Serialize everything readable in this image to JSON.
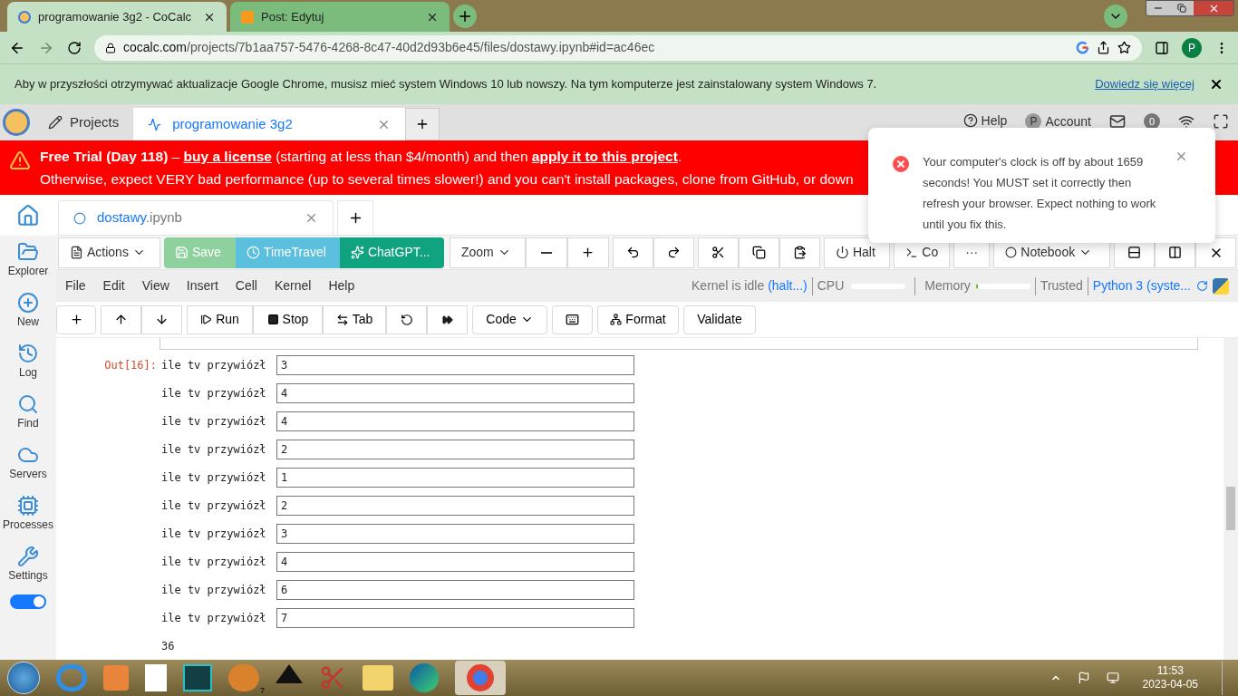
{
  "browser": {
    "tabs": [
      {
        "title": "programowanie 3g2 - CoCalc",
        "selected": true
      },
      {
        "title": "Post: Edytuj",
        "selected": false
      }
    ],
    "url": {
      "host": "cocalc.com",
      "path": "/projects/7b1aa757-5476-4268-8c47-40d2d93b6e45/files/dostawy.ipynb#id=ac46ec"
    },
    "profile": "P"
  },
  "update_bar": {
    "message": "Aby w przyszłości otrzymywać aktualizacje Google Chrome, musisz mieć system Windows 10 lub nowszy. Na tym komputerze jest zainstalowany system Windows 7.",
    "link": "Dowiedz się więcej"
  },
  "top_bar": {
    "projects": "Projects",
    "project_tab": {
      "title": "programowanie 3g2",
      "selected": true
    },
    "help": "Help",
    "account": "Account",
    "account_initial": "P",
    "notifications": "0"
  },
  "banner": {
    "line1": [
      {
        "kind": "bold",
        "text": "Free Trial (Day 118)"
      },
      {
        "kind": "plain",
        "text": " – "
      },
      {
        "kind": "link",
        "text": "buy a license"
      },
      {
        "kind": "plain",
        "text": " (starting at less than $4/month) and then "
      },
      {
        "kind": "link",
        "text": "apply it to this project"
      },
      {
        "kind": "plain",
        "text": "."
      }
    ],
    "line2": "Otherwise, expect VERY bad performance (up to several times slower!) and you can't install packages, clone from GitHub, or down"
  },
  "sidebar": {
    "items": [
      {
        "label": "Explorer"
      },
      {
        "label": "New"
      },
      {
        "label": "Log"
      },
      {
        "label": "Find"
      },
      {
        "label": "Servers"
      },
      {
        "label": "Processes"
      },
      {
        "label": "Settings"
      }
    ],
    "toggle_on": true
  },
  "file_tab": {
    "name": "dostawy",
    "ext": ".ipynb",
    "selected": true
  },
  "toolbar": {
    "actions": "Actions",
    "save": "Save",
    "timetravel": "TimeTravel",
    "chatgpt": "ChatGPT...",
    "zoom": "Zoom",
    "halt": "Halt",
    "terminal": "Co",
    "more": "···",
    "view": "Notebook"
  },
  "menu": [
    "File",
    "Edit",
    "View",
    "Insert",
    "Cell",
    "Kernel",
    "Help"
  ],
  "status": {
    "kernel": "Kernel is idle",
    "halt": "(halt...)",
    "cpu": "CPU",
    "cpu_meter": {
      "level": 0
    },
    "memory": "Memory",
    "memory_meter": {
      "level": 0.03
    },
    "trusted": "Trusted",
    "kernel_name": "Python 3 (syste..."
  },
  "cell_toolbar": {
    "run": "Run",
    "stop": "Stop",
    "tab": "Tab",
    "cell_type": "Code",
    "format": "Format",
    "validate": "Validate"
  },
  "output": {
    "prompt": "Out[16]:",
    "rows": [
      {
        "label": "ile tv przywiózł",
        "value": "3"
      },
      {
        "label": "ile tv przywiózł",
        "value": "4"
      },
      {
        "label": "ile tv przywiózł",
        "value": "4"
      },
      {
        "label": "ile tv przywiózł",
        "value": "2"
      },
      {
        "label": "ile tv przywiózł",
        "value": "1"
      },
      {
        "label": "ile tv przywiózł",
        "value": "2"
      },
      {
        "label": "ile tv przywiózł",
        "value": "3"
      },
      {
        "label": "ile tv przywiózł",
        "value": "4"
      },
      {
        "label": "ile tv przywiózł",
        "value": "6"
      },
      {
        "label": "ile tv przywiózł",
        "value": "7"
      }
    ],
    "result": "36"
  },
  "notification": {
    "message": "Your computer's clock is off by about 1659 seconds! You MUST set it correctly then refresh your browser. Expect nothing to work until you fix this."
  },
  "taskbar": {
    "badge": "7",
    "time": "11:53",
    "date": "2023-04-05"
  }
}
